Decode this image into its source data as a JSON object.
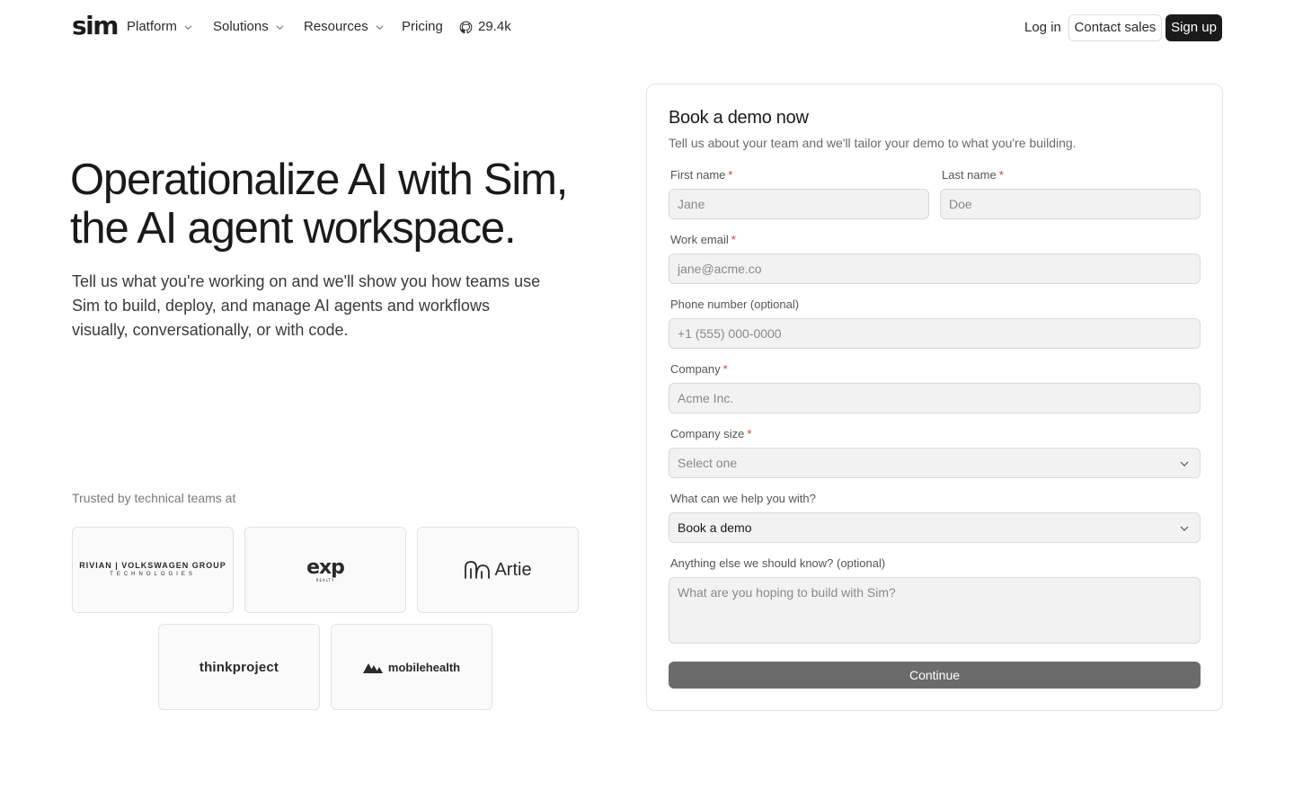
{
  "nav": {
    "logo": "sim",
    "links": [
      {
        "label": "Platform",
        "has_dropdown": true
      },
      {
        "label": "Solutions",
        "has_dropdown": true
      },
      {
        "label": "Resources",
        "has_dropdown": true
      },
      {
        "label": "Pricing",
        "has_dropdown": false
      }
    ],
    "github_stars": "29.4k",
    "login_label": "Log in",
    "contact_label": "Contact sales",
    "signup_label": "Sign up"
  },
  "hero": {
    "title_line1": "Operationalize AI with Sim,",
    "title_line2": "the AI agent workspace.",
    "subtitle": "Tell us what you're working on and we'll show you how teams use Sim to build, deploy, and manage AI agents and workflows visually, conversationally, or with code."
  },
  "trusted": {
    "label": "Trusted by technical teams at",
    "logos": [
      {
        "name": "Rivian | Volkswagen Group Technologies",
        "line1": "RIVIAN | VOLKSWAGEN GROUP",
        "line2": "TECHNOLOGIES"
      },
      {
        "name": "eXp Realty",
        "main": "exp",
        "small": "REALTY"
      },
      {
        "name": "Artie",
        "text": "Artie"
      },
      {
        "name": "thinkproject",
        "text": "thinkproject"
      },
      {
        "name": "mobilehealth",
        "text": "mobilehealth"
      }
    ]
  },
  "form": {
    "title": "Book a demo now",
    "subtitle": "Tell us about your team and we'll tailor your demo to what you're building.",
    "first_name": {
      "label": "First name",
      "required": "*",
      "placeholder": "Jane",
      "value": ""
    },
    "last_name": {
      "label": "Last name",
      "required": "*",
      "placeholder": "Doe",
      "value": ""
    },
    "work_email": {
      "label": "Work email",
      "required": "*",
      "placeholder": "jane@acme.co",
      "value": ""
    },
    "phone": {
      "label": "Phone number (optional)",
      "placeholder": "+1 (555) 000-0000",
      "value": ""
    },
    "company": {
      "label": "Company",
      "required": "*",
      "placeholder": "Acme Inc.",
      "value": ""
    },
    "company_size": {
      "label": "Company size",
      "required": "*",
      "selected": "Select one"
    },
    "help_with": {
      "label": "What can we help you with?",
      "selected": "Book a demo"
    },
    "notes": {
      "label": "Anything else we should know? (optional)",
      "placeholder": "What are you hoping to build with Sim?"
    },
    "submit_label": "Continue"
  },
  "colors": {
    "primary_dark": "#1a1a1a",
    "required_red": "#e0392b",
    "input_bg": "#f2f2f2",
    "continue_bg": "#6b6b6b"
  },
  "icons": [
    "chevron-down-icon",
    "github-icon"
  ]
}
